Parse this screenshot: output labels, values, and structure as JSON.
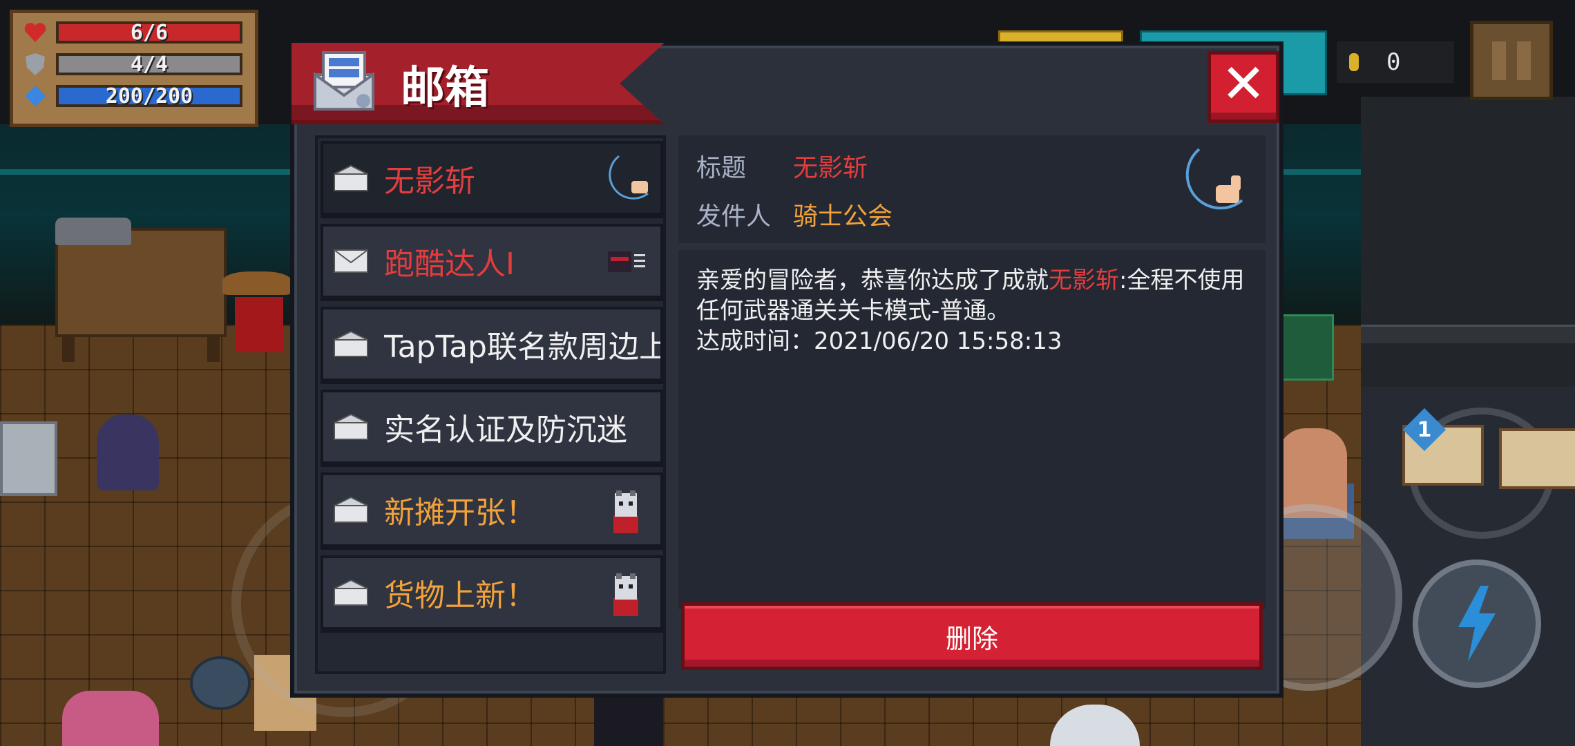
{
  "hud": {
    "hp": {
      "text": "6/6",
      "fraction": 1.0
    },
    "armor": {
      "text": "4/4",
      "fraction": 1.0
    },
    "energy": {
      "text": "200/200",
      "fraction": 1.0
    },
    "coins": "0"
  },
  "dialog": {
    "title": "邮箱",
    "close_label": "✕",
    "mails": [
      {
        "label": "无影斩",
        "color": "#e33d3d",
        "thumb": "crescent-hand-icon",
        "opened": true
      },
      {
        "label": "跑酷达人I",
        "color": "#e33d3d",
        "thumb": "ninja-icon",
        "opened": false
      },
      {
        "label": "TapTap联名款周边上",
        "color": "#f0f0f0",
        "thumb": "",
        "opened": true
      },
      {
        "label": "实名认证及防沉迷",
        "color": "#f0f0f0",
        "thumb": "",
        "opened": true
      },
      {
        "label": "新摊开张！",
        "color": "#f2a23a",
        "thumb": "cat-merchant-icon",
        "opened": true
      },
      {
        "label": "货物上新！",
        "color": "#f2a23a",
        "thumb": "cat-merchant-icon",
        "opened": true
      }
    ],
    "detail": {
      "title_key": "标题",
      "title_value": "无影斩",
      "sender_key": "发件人",
      "sender_value": "骑士公会",
      "body_prefix": "亲爱的冒险者，恭喜你达成了成就",
      "body_highlight": "无影斩",
      "body_suffix": ":全程不使用任何武器通关关卡模式-普通。",
      "time_line": "达成时间：2021/06/20 15:58:13"
    },
    "delete_label": "删除"
  },
  "colors": {
    "accent_red": "#d42133",
    "title_red": "#e33d3d",
    "orange": "#f2a23a",
    "panel": "#232833"
  }
}
